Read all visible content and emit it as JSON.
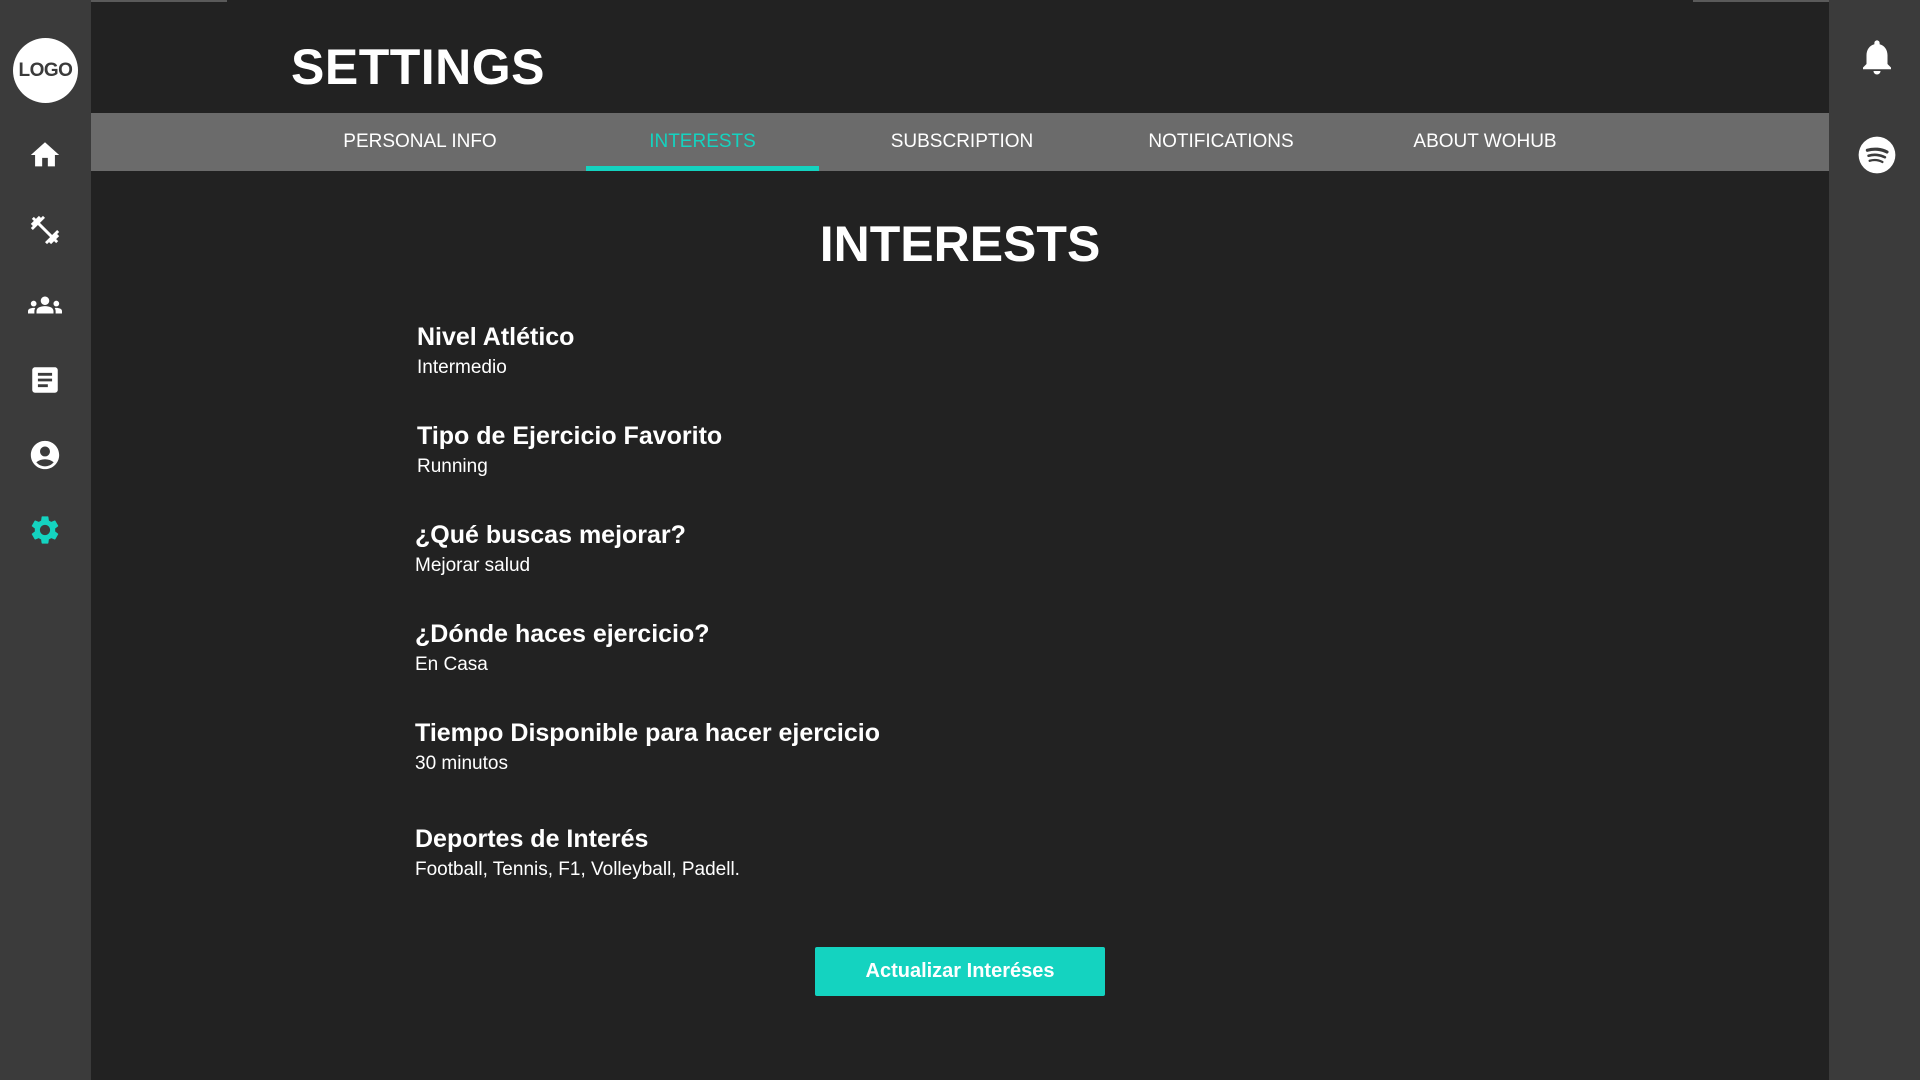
{
  "logo": {
    "text": "LOGO"
  },
  "sidebar": {
    "items": [
      {
        "icon": "home-icon"
      },
      {
        "icon": "dumbbell-icon"
      },
      {
        "icon": "community-icon"
      },
      {
        "icon": "document-icon"
      },
      {
        "icon": "account-icon"
      },
      {
        "icon": "gear-icon",
        "active": true
      }
    ]
  },
  "rightbar": {
    "items": [
      {
        "icon": "bell-icon"
      },
      {
        "icon": "spotify-icon"
      }
    ]
  },
  "header": {
    "title": "SETTINGS"
  },
  "tabs": [
    {
      "label": "PERSONAL INFO"
    },
    {
      "label": "INTERESTS",
      "active": true
    },
    {
      "label": "SUBSCRIPTION"
    },
    {
      "label": "NOTIFICATIONS"
    },
    {
      "label": "ABOUT WOHUB"
    }
  ],
  "section": {
    "title": "INTERESTS",
    "fields": [
      {
        "label": "Nivel Atlético",
        "value": "Intermedio"
      },
      {
        "label": "Tipo de Ejercicio Favorito",
        "value": "Running"
      },
      {
        "label": "¿Qué buscas mejorar?",
        "value": "Mejorar salud"
      },
      {
        "label": "¿Dónde haces ejercicio?",
        "value": "En Casa"
      },
      {
        "label": "Tiempo Disponible para hacer ejercicio",
        "value": "30 minutos"
      },
      {
        "label": "Deportes de Interés",
        "value": "Football, Tennis, F1, Volleyball, Padell."
      }
    ],
    "button_label": "Actualizar Interéses"
  },
  "colors": {
    "accent": "#14d3c0",
    "sidebar": "#3b3b3b",
    "main_bg": "#222222",
    "tabbar": "#6b6b6b"
  }
}
